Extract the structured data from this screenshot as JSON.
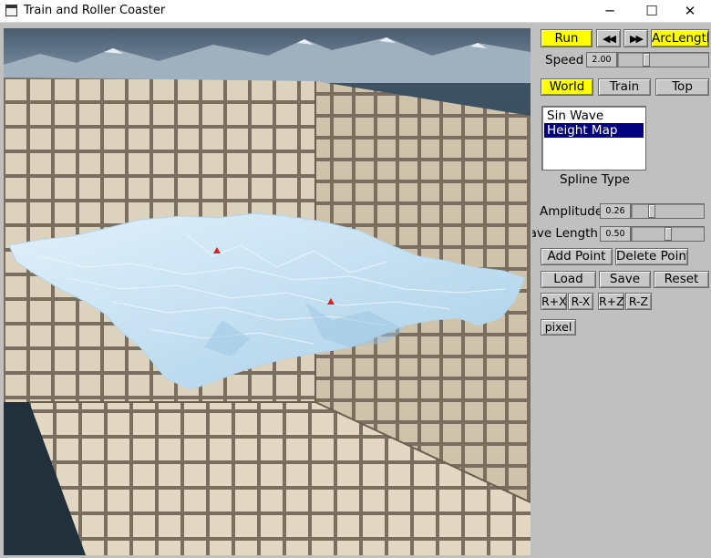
{
  "window": {
    "title": "Train and Roller Coaster",
    "minimize_icon": "─",
    "maximize_icon": "☐",
    "close_icon": "✕"
  },
  "toolbar": {
    "run_label": "Run",
    "rewind_icon": "◀◀",
    "forward_icon": "▶▶",
    "arclength_label": "ArcLength"
  },
  "speed": {
    "label": "Speed",
    "value": "2.00",
    "level": 0.3
  },
  "views": {
    "world_label": "World",
    "train_label": "Train",
    "top_label": "Top",
    "active": "World"
  },
  "spline": {
    "items": [
      "Sin Wave",
      "Height Map"
    ],
    "selected": "Height Map",
    "caption": "Spline Type"
  },
  "amplitude": {
    "label": "Amplitude",
    "value": "0.26",
    "level": 0.26
  },
  "wave_length": {
    "label": "Wave Length",
    "value": "0.50",
    "level": 0.5
  },
  "points": {
    "add_label": "Add Point",
    "delete_label": "Delete Point"
  },
  "file": {
    "load_label": "Load",
    "save_label": "Save",
    "reset_label": "Reset"
  },
  "rotate": {
    "rpx_label": "R+X",
    "rmx_label": "R-X",
    "rpz_label": "R+Z",
    "rmz_label": "R-Z"
  },
  "pixel_label": "pixel",
  "colors": {
    "active_button": "#ffff00",
    "selection": "#000080",
    "tile": "#ddd2bd",
    "grout": "#7a6e60",
    "water": "#cfe6f4"
  }
}
